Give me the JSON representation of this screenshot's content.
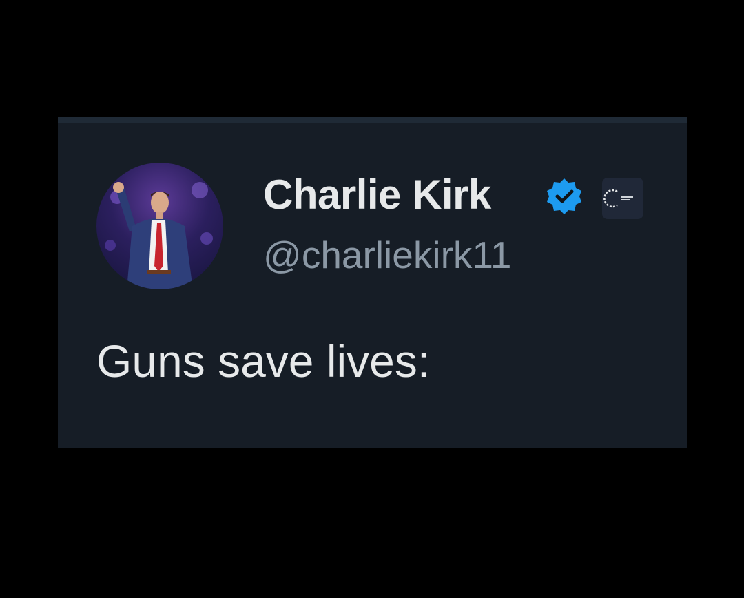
{
  "tweet": {
    "display_name": "Charlie Kirk",
    "handle": "@charliekirk11",
    "text": "Guns save lives:",
    "verified_icon": "verified-badge-icon",
    "affiliate_icon": "affiliate-logo-icon"
  },
  "colors": {
    "page_background": "#000000",
    "card_background": "#161d26",
    "name_text": "#e7e9ea",
    "handle_text": "#8b98a5",
    "verified_blue": "#1d9bf0"
  }
}
